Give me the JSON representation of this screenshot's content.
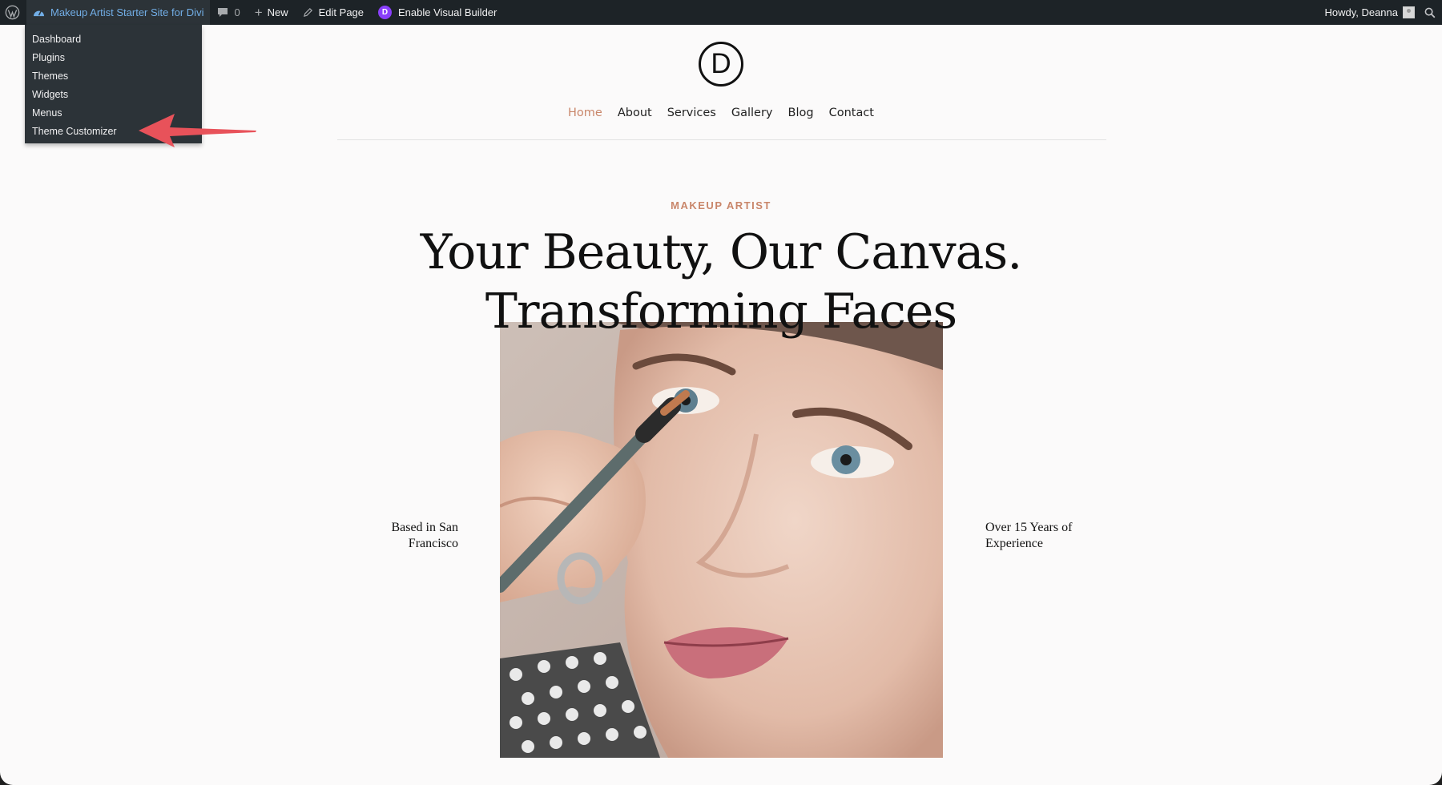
{
  "admin_bar": {
    "site_name": "Makeup Artist Starter Site for Divi",
    "comments_count": "0",
    "new_label": "New",
    "edit_label": "Edit Page",
    "visual_builder_label": "Enable Visual Builder",
    "greeting": "Howdy, Deanna"
  },
  "site_menu": {
    "items": [
      "Dashboard",
      "Plugins",
      "Themes",
      "Widgets",
      "Menus",
      "Theme Customizer"
    ]
  },
  "site": {
    "logo_letter": "D",
    "nav": [
      "Home",
      "About",
      "Services",
      "Gallery",
      "Blog",
      "Contact"
    ],
    "active_nav": "Home"
  },
  "hero": {
    "eyebrow": "MAKEUP ARTIST",
    "headline_line1": "Your Beauty, Our Canvas.",
    "headline_line2": "Transforming Faces",
    "left_text": "Based in San Francisco",
    "right_text": "Over 15 Years of Experience"
  },
  "colors": {
    "accent": "#c9866a",
    "admin_bar": "#1d2327",
    "admin_link": "#72aee6",
    "annotation_arrow": "#e8525a"
  }
}
